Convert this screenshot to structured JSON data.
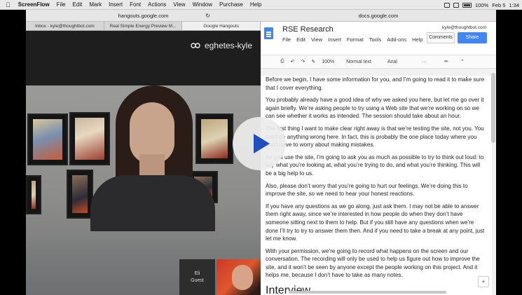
{
  "menubar": {
    "apple": "",
    "app": "ScreenFlow",
    "items": [
      "File",
      "Edit",
      "Mark",
      "Insert",
      "Font",
      "Actions",
      "View",
      "Window",
      "Purchase",
      "Help"
    ],
    "battery": "100%",
    "date": "Feb 5",
    "time": "1:34"
  },
  "left_window": {
    "url": "hangouts.google.com",
    "tabs": [
      "Inbox - kyle@thoughtbot.com",
      "Real Simple Energy Preview M...",
      "Google Hangouts"
    ],
    "meeting_name": "eghetes-kyle",
    "guest_name": "Eli",
    "guest_role": "Guest"
  },
  "right_window": {
    "url": "docs.google.com",
    "doc_title": "RSE Research",
    "account": "kyle@thoughtbot.com",
    "menu": [
      "File",
      "Edit",
      "View",
      "Insert",
      "Format",
      "Tools",
      "Add-ons",
      "Help"
    ],
    "comments_label": "Comments",
    "share_label": "Share",
    "toolbar": {
      "zoom": "100%",
      "style": "Normal text",
      "font": "Arial",
      "more": "···"
    },
    "paragraphs": [
      [
        "Before we begin, I have some information for you, and I’m going to read it to make sure",
        "that I cover everything."
      ],
      [
        "You probably already have a good idea of why we asked you here, but let me go over it",
        "again briefly. We’re asking people to try using a Web site that we’re working on so we",
        "can see whether it works as intended. The session should take about an hour."
      ],
      [
        "The first thing I want to make clear right away is that we’re testing the site, not you. You",
        "can’t do anything wrong here. In fact, this is probably the one place today where you",
        "don’t have to worry about making mistakes."
      ],
      [
        "As you use the site, I’m going to ask you as much as possible to try to think out loud: to",
        "say what you’re looking at, what you’re trying to do, and what you’re thinking. This will",
        "be a big help to us."
      ],
      [
        "Also, please don’t worry that you’re going to hurt our feelings. We’re doing this to",
        "improve the site, so we need to hear your honest reactions."
      ],
      [
        "If you have any questions as we go along, just ask them. I may not be able to answer",
        "them right away, since we’re interested in how people do when they don’t have",
        "someone sitting next to them to help. But if you still have any questions when we’re",
        "done I’ll try to try to answer them then. And if you need to take a break at any point, just",
        "let me know."
      ],
      [
        "With your permission, we’re going to record what happens on the screen and our",
        "conversation. The recording will only be used to help us figure out how to improve the",
        "site, and it won’t be seen by anyone except the people working on this project. And it",
        "helps me, because I don’t have to take as many notes."
      ]
    ],
    "heading": "Interview"
  },
  "icons": [
    "apple-icon",
    "link-icon",
    "play-icon",
    "docs-icon",
    "reload-icon",
    "print-icon",
    "undo-icon",
    "redo-icon",
    "paint-format-icon",
    "pencil-icon",
    "collapse-icon",
    "explore-icon"
  ]
}
